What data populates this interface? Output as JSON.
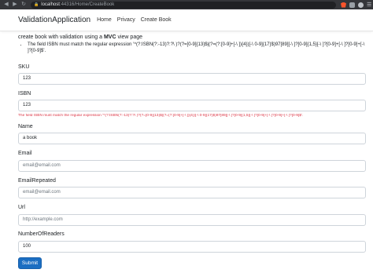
{
  "browser": {
    "url_host": "localhost",
    "url_path": ":44316/Home/CreateBook"
  },
  "navbar": {
    "brand": "ValidationApplication",
    "links": [
      "Home",
      "Privacy",
      "Create Book"
    ]
  },
  "intro": {
    "text_before": "create book with validation using a ",
    "bold": "MVC",
    "text_after": " view page",
    "bullet": "The field ISBN must match the regular expression '^(?:ISBN(?:-13)?:?\\ )?(?=[0-9]{13}$|(?=(?:[0-9]+[-\\ ]){4})[-\\ 0-9]{17}$)97[89][-\\ ]?[0-9]{1,5}[-\\ ]?[0-9]+[-\\ ]?[0-9]+[-\\ ]?[0-9]$'."
  },
  "fields": {
    "sku": {
      "label": "SKU",
      "value": "123"
    },
    "isbn": {
      "label": "ISBN",
      "value": "123",
      "error": "The field ISBN must match the regular expression '^(?:ISBN(?:-13)?:?\\ )?(?=[0-9]{13}$|(?=(?:[0-9]+[-\\ ]){4})[-\\ 0-9]{17}$)97[89][-\\ ]?[0-9]{1,5}[-\\ ]?[0-9]+[-\\ ]?[0-9]+[-\\ ]?[0-9]$'."
    },
    "name": {
      "label": "Name",
      "value": "a book"
    },
    "email": {
      "label": "Email",
      "placeholder": "email@email.com"
    },
    "email_repeated": {
      "label": "EmailRepeated",
      "placeholder": "email@email.com"
    },
    "url": {
      "label": "Url",
      "placeholder": "http://example.com"
    },
    "number_of_readers": {
      "label": "NumberOfReaders",
      "value": "100"
    }
  },
  "submit_label": "Submit",
  "colors": {
    "primary": "#1b6ec2",
    "error": "#dc3545",
    "browser_chrome": "#35363a"
  }
}
